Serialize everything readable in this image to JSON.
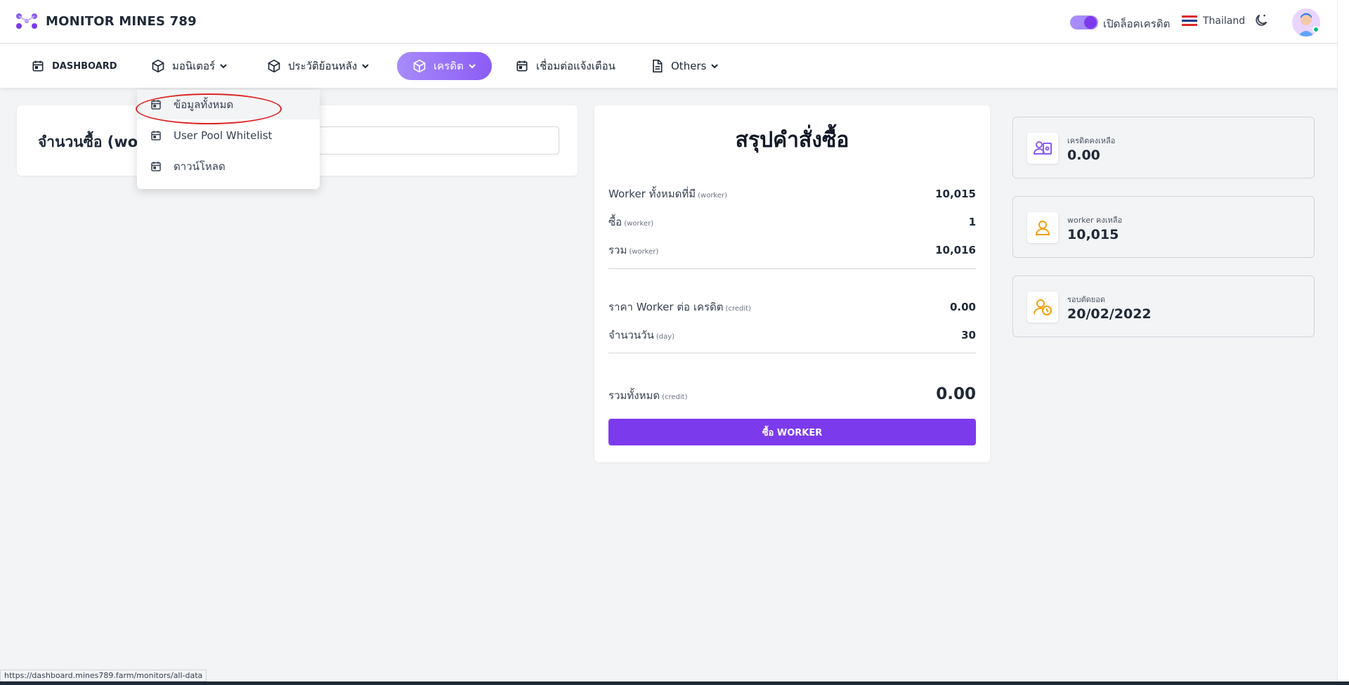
{
  "header": {
    "app_title": "MONITOR MINES 789",
    "toggle_label": "เปิดล็อคเครดิต",
    "toggle_on": true,
    "language": "Thailand"
  },
  "nav": {
    "dashboard": "DASHBOARD",
    "monitor": "มอนิเตอร์",
    "history": "ประวัติย้อนหลัง",
    "credit": "เครดิต",
    "notify": "เชื่อมต่อแจ้งเตือน",
    "others": "Others"
  },
  "dropdown": {
    "items": [
      "ข้อมูลทั้งหมด",
      "User Pool Whitelist",
      "ดาวน์โหลด"
    ]
  },
  "purchase": {
    "quantity_label": "จำนวนซื้อ (worker)",
    "quantity_value": ""
  },
  "summary": {
    "title": "สรุปคำสั่งซื้อ",
    "rows": [
      {
        "label": "Worker ทั้งหมดที่มี",
        "unit": "(worker)",
        "value": "10,015"
      },
      {
        "label": "ซื้อ",
        "unit": "(worker)",
        "value": "1"
      },
      {
        "label": "รวม",
        "unit": "(worker)",
        "value": "10,016"
      },
      {
        "label": "ราคา Worker ต่อ เครดิต",
        "unit": "(credit)",
        "value": "0.00"
      },
      {
        "label": "จำนวนวัน",
        "unit": "(day)",
        "value": "30"
      },
      {
        "label": "รวมทั้งหมด",
        "unit": "(credit)",
        "value": "0.00"
      }
    ],
    "buy_button": "ซื้อ WORKER"
  },
  "stats": [
    {
      "label": "เครดิตคงเหลือ",
      "value": "0.00",
      "icon": "wallet-icon"
    },
    {
      "label": "worker คงเหลือ",
      "value": "10,015",
      "icon": "user-icon"
    },
    {
      "label": "รอบตัดยอด",
      "value": "20/02/2022",
      "icon": "user-clock-icon"
    }
  ],
  "status_url": "https://dashboard.mines789.farm/monitors/all-data",
  "colors": {
    "accent": "#7c3aed",
    "accent_light": "#a78bfa",
    "icon_purple": "#8b5cf6",
    "icon_orange": "#f59e0b",
    "highlight_ring": "#dc2626"
  }
}
